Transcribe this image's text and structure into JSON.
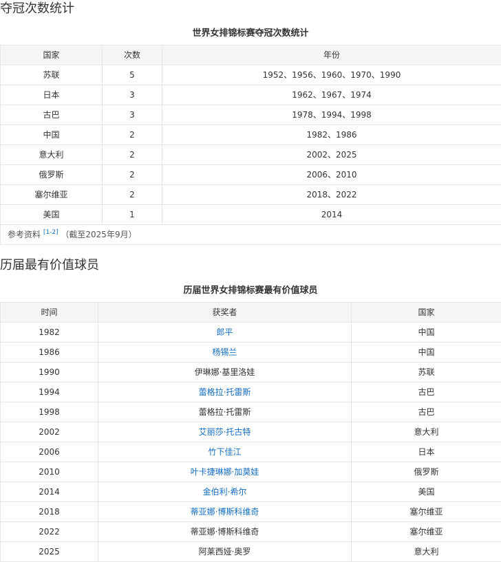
{
  "section1": {
    "heading": "夺冠次数统计",
    "caption": "世界女排锦标赛夺冠次数统计",
    "headers": [
      "国家",
      "次数",
      "年份"
    ],
    "rows": [
      {
        "country": "苏联",
        "count": "5",
        "years": "1952、1956、1960、1970、1990"
      },
      {
        "country": "日本",
        "count": "3",
        "years": "1962、1967、1974"
      },
      {
        "country": "古巴",
        "count": "3",
        "years": "1978、1994、1998"
      },
      {
        "country": "中国",
        "count": "2",
        "years": "1982、1986"
      },
      {
        "country": "意大利",
        "count": "2",
        "years": "2002、2025"
      },
      {
        "country": "俄罗斯",
        "count": "2",
        "years": "2006、2010"
      },
      {
        "country": "塞尔维亚",
        "count": "2",
        "years": "2018、2022"
      },
      {
        "country": "美国",
        "count": "1",
        "years": "2014"
      }
    ],
    "footnote": {
      "prefix": "参考资料",
      "ref": "[1-2]",
      "suffix": "（截至2025年9月）"
    }
  },
  "section2": {
    "heading": "历届最有价值球员",
    "caption": "历届世界女排锦标赛最有价值球员",
    "headers": [
      "时间",
      "获奖者",
      "国家"
    ],
    "rows": [
      {
        "year": "1982",
        "winner": "郎平",
        "country": "中国",
        "linked": true
      },
      {
        "year": "1986",
        "winner": "杨锡兰",
        "country": "中国",
        "linked": true
      },
      {
        "year": "1990",
        "winner": "伊琳娜·基里洛娃",
        "country": "苏联",
        "linked": false
      },
      {
        "year": "1994",
        "winner": "蕾格拉·托雷斯",
        "country": "古巴",
        "linked": true
      },
      {
        "year": "1998",
        "winner": "蕾格拉·托雷斯",
        "country": "古巴",
        "linked": false
      },
      {
        "year": "2002",
        "winner": "艾丽莎·托古特",
        "country": "意大利",
        "linked": true
      },
      {
        "year": "2006",
        "winner": "竹下佳江",
        "country": "日本",
        "linked": true
      },
      {
        "year": "2010",
        "winner": "叶卡捷琳娜·加莫娃",
        "country": "俄罗斯",
        "linked": true
      },
      {
        "year": "2014",
        "winner": "金伯利·希尔",
        "country": "美国",
        "linked": true
      },
      {
        "year": "2018",
        "winner": "蒂亚娜·博斯科维奇",
        "country": "塞尔维亚",
        "linked": true
      },
      {
        "year": "2022",
        "winner": "蒂亚娜·博斯科维奇",
        "country": "塞尔维亚",
        "linked": false
      },
      {
        "year": "2025",
        "winner": "阿莱西娅·奥罗",
        "country": "意大利",
        "linked": false
      }
    ]
  },
  "colors": {
    "link": "#136ec2",
    "header_bg": "#f5f5f5",
    "border": "#e6e6e6",
    "text": "#333333"
  }
}
